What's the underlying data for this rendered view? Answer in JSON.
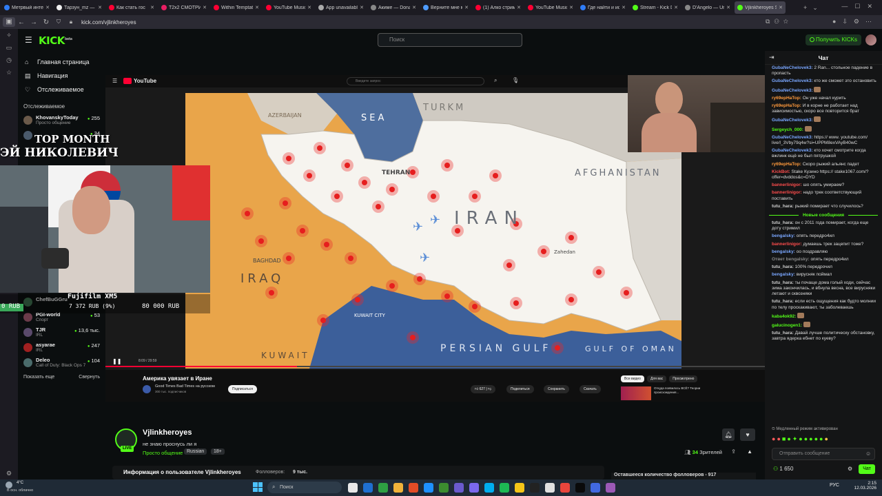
{
  "browser": {
    "tabs": [
      {
        "label": "Метрвый интер",
        "color": "#2f7cf6"
      },
      {
        "label": "Тарзун_mz — Bo",
        "color": "#f0f0f0"
      },
      {
        "label": "Как стать гос",
        "color": "#ff0033"
      },
      {
        "label": "T2x2 СМОТРИТ",
        "color": "#e91e63"
      },
      {
        "label": "Within Temptatio",
        "color": "#ff0033"
      },
      {
        "label": "YouTube Music",
        "color": "#ff0033"
      },
      {
        "label": "App unavailable",
        "color": "#aaaaaa"
      },
      {
        "label": "Акиме — Donati",
        "color": "#888888"
      },
      {
        "label": "Верните мне мо",
        "color": "#4e9cff"
      },
      {
        "label": "(1) Алко стрим",
        "color": "#ff0033"
      },
      {
        "label": "YouTube Music",
        "color": "#ff0033"
      },
      {
        "label": "Где найти и исп",
        "color": "#2f7cf6"
      },
      {
        "label": "Stream - Kick Da",
        "color": "#53fc18"
      },
      {
        "label": "D'Angelo — Unsh",
        "color": "#888888"
      },
      {
        "label": "Vjlinkheroyes Str",
        "color": "#53fc18"
      }
    ],
    "url": "kick.com/vjlinkheroyes"
  },
  "header": {
    "logo": "KICK",
    "logo_sup": "beta",
    "search_placeholder": "Поиск",
    "get_kicks": "Получить KICKs"
  },
  "nav": {
    "items": [
      "Главная страница",
      "Навигация",
      "Отслеживаемое"
    ],
    "section_title": "Отслеживаемое",
    "channels_top": [
      {
        "name": "KhovanskyToday",
        "category": "Просто общение",
        "viewers": "255"
      },
      {
        "name": "",
        "category": "",
        "viewers": "34"
      }
    ],
    "channels_bottom": [
      {
        "name": "ChefBuGGru",
        "category": "",
        "viewers": ""
      },
      {
        "name": "PGI-world",
        "category": "Спорт",
        "viewers": "53"
      },
      {
        "name": "TJR",
        "category": "IRL",
        "viewers": "13,6 тыс."
      },
      {
        "name": "asyarae",
        "category": "IRL",
        "viewers": "247"
      },
      {
        "name": "Deleo",
        "category": "Call of Duty: Black Ops 7",
        "viewers": "104"
      }
    ],
    "show_more": "Показать еще",
    "collapse": "Свернуть"
  },
  "overlay": {
    "top_month": "TOP MONTH",
    "name_banner": "ЭЙ НИКОЛЕВИЧ",
    "camera_label": "Fujifilm XM5",
    "donation_left": "0 RUB",
    "donation_progress": "7 372 RUB (9%)",
    "donation_goal": "80 000 RUB"
  },
  "youtube": {
    "logo": "YouTube",
    "search_placeholder": "Введите запрос",
    "time": "8:09 / 29:59",
    "video_title": "Америка увязает в Иране",
    "channel": "Good Times Bad Times на русском",
    "subscribers": "300 тыс. подписчиков",
    "subscribe": "Подписаться",
    "likes": "627",
    "share": "Поделиться",
    "save": "Сохранить",
    "download": "Скачать",
    "chips": [
      "Все видео",
      "Для вас",
      "Просмотрено"
    ],
    "rec_title": "Откуда появилось ВСЁ? Теории происхождения..."
  },
  "map": {
    "labels": {
      "country_main": "IRAN",
      "iraq": "IRAQ",
      "kuwait": "KUWAIT",
      "afghanistan": "AFGHANISTAN",
      "sea": "SEA",
      "turkmenistan": "TURKM",
      "persian_gulf": "PERSIAN GULF",
      "gulf_of_oman": "GULF OF OMAN",
      "azerbaijan": "AZERBAIJAN",
      "tehran": "TEHRAN",
      "baghdad": "BAGHDAD",
      "zahedan": "Zahedan",
      "kuwait_city": "KUWAIT CITY"
    }
  },
  "streamer": {
    "name": "Vjlinkheroyes",
    "title": "не знаю проснусь ли я",
    "category": "Просто общение",
    "tags": [
      "Russian",
      "18+"
    ],
    "viewers": "34",
    "viewers_label": "Зрителей",
    "live": "LIVE",
    "info_title": "Информация о пользователе Vjlinkheroyes",
    "followers_label": "Фолловеров:",
    "followers": "9 тыс.",
    "remaining": "Оставшееся количество фолловеров - 917"
  },
  "chat": {
    "title": "Чат",
    "messages": [
      {
        "user": "GubaNeChelovek3:",
        "text": "2 Ran... стольное падение в пропасть",
        "color": "#7aa7ff"
      },
      {
        "user": "GubaNeChelovek3:",
        "text": "кто же сможет это остановить",
        "color": "#7aa7ff"
      },
      {
        "user": "GubaNeChelovek3:",
        "text": "",
        "color": "#7aa7ff"
      },
      {
        "user": "ry69epHaTop:",
        "text": "Он уже начал курить",
        "color": "#ff9a3c"
      },
      {
        "user": "ry69epHaTop:",
        "text": "И в корне не работает над зависимостью, скоро все повторится брат",
        "color": "#ff9a3c"
      },
      {
        "user": "GubaNeChelovek3:",
        "text": "",
        "color": "#7aa7ff"
      },
      {
        "user": "Sergeych_000:",
        "text": "",
        "color": "#53fc18"
      },
      {
        "user": "GubaNeChelovek3:",
        "text": "https:// www. youtube.com/ live/l_3Vby79q4w?si=UPPM8exVAyB40wC",
        "color": "#7aa7ff"
      },
      {
        "user": "GubaNeChelovek3:",
        "text": "кто хочет смотрите когда вжлинк ещё не был пятрушкой",
        "color": "#7aa7ff"
      },
      {
        "user": "ry69epHaTop:",
        "text": "Скоро рыжий альянс падет",
        "color": "#ff9a3c"
      },
      {
        "user": "KickBot:",
        "text": "Stake Кузино https:// stake1067.com/?offer=dvddos&c=DYD",
        "color": "#ff4d4d"
      },
      {
        "user": "bannerlinigor:",
        "text": "шо опять умираем?",
        "color": "#ff4d4d"
      },
      {
        "user": "bannerlinigor:",
        "text": "надо трек соответствующий поставить",
        "color": "#ff4d4d"
      },
      {
        "user": "tutu_hara:",
        "text": "рыжий помирает что случилось?",
        "color": "#cfcfcf"
      }
    ],
    "new_messages": "Новые сообщения",
    "messages2": [
      {
        "user": "tutu_hara:",
        "text": "он с 2011 года помирает, когда еще доту стримил",
        "color": "#cfcfcf"
      },
      {
        "user": "bengalsky:",
        "text": "опять передро4ил",
        "color": "#7aa7ff"
      },
      {
        "user": "bannerlinigor:",
        "text": "думаешь трек зацепит тоже?",
        "color": "#ff4d4d"
      },
      {
        "user": "bengalsky:",
        "text": "оо поздравляю",
        "color": "#7aa7ff"
      },
      {
        "user": "Ответ bengalsky:",
        "text": "опять передро4ил",
        "color": "#888888"
      },
      {
        "user": "tutu_hara:",
        "text": "100% передрочил",
        "color": "#cfcfcf"
      },
      {
        "user": "bengalsky:",
        "text": "вирусняк поймал",
        "color": "#7aa7ff"
      },
      {
        "user": "tutu_hara:",
        "text": "ты почаще дома голый ходи, сейчас зима закончилась, и вбнула весна, все вирусняки летают и сквозняки",
        "color": "#cfcfcf"
      },
      {
        "user": "tutu_hara:",
        "text": "если есть ощущения как будто молнии по телу проскакивают, ты заболеваешь",
        "color": "#cfcfcf"
      },
      {
        "user": "kaba4ok92:",
        "text": "",
        "color": "#53fc18"
      },
      {
        "user": "galucinogen1:",
        "text": "",
        "color": "#53fc18"
      },
      {
        "user": "tutu_hara:",
        "text": "Давай лучше политическу обстановку, завтра ядерка ебнет по куеву?",
        "color": "#cfcfcf"
      }
    ],
    "slow_mode": "Медленный режим активирован",
    "input_placeholder": "Отправить сообщение",
    "points": "1 650",
    "send": "Чат"
  },
  "taskbar": {
    "weather_temp": "4°C",
    "weather_desc": "В осн. облачно",
    "search": "Поиск",
    "lang": "РУС",
    "time": "2:15",
    "date": "12.03.2026"
  },
  "colors": {
    "kick_green": "#53fc18",
    "bg": "#0b0e0f",
    "chat_bg": "#141516"
  }
}
